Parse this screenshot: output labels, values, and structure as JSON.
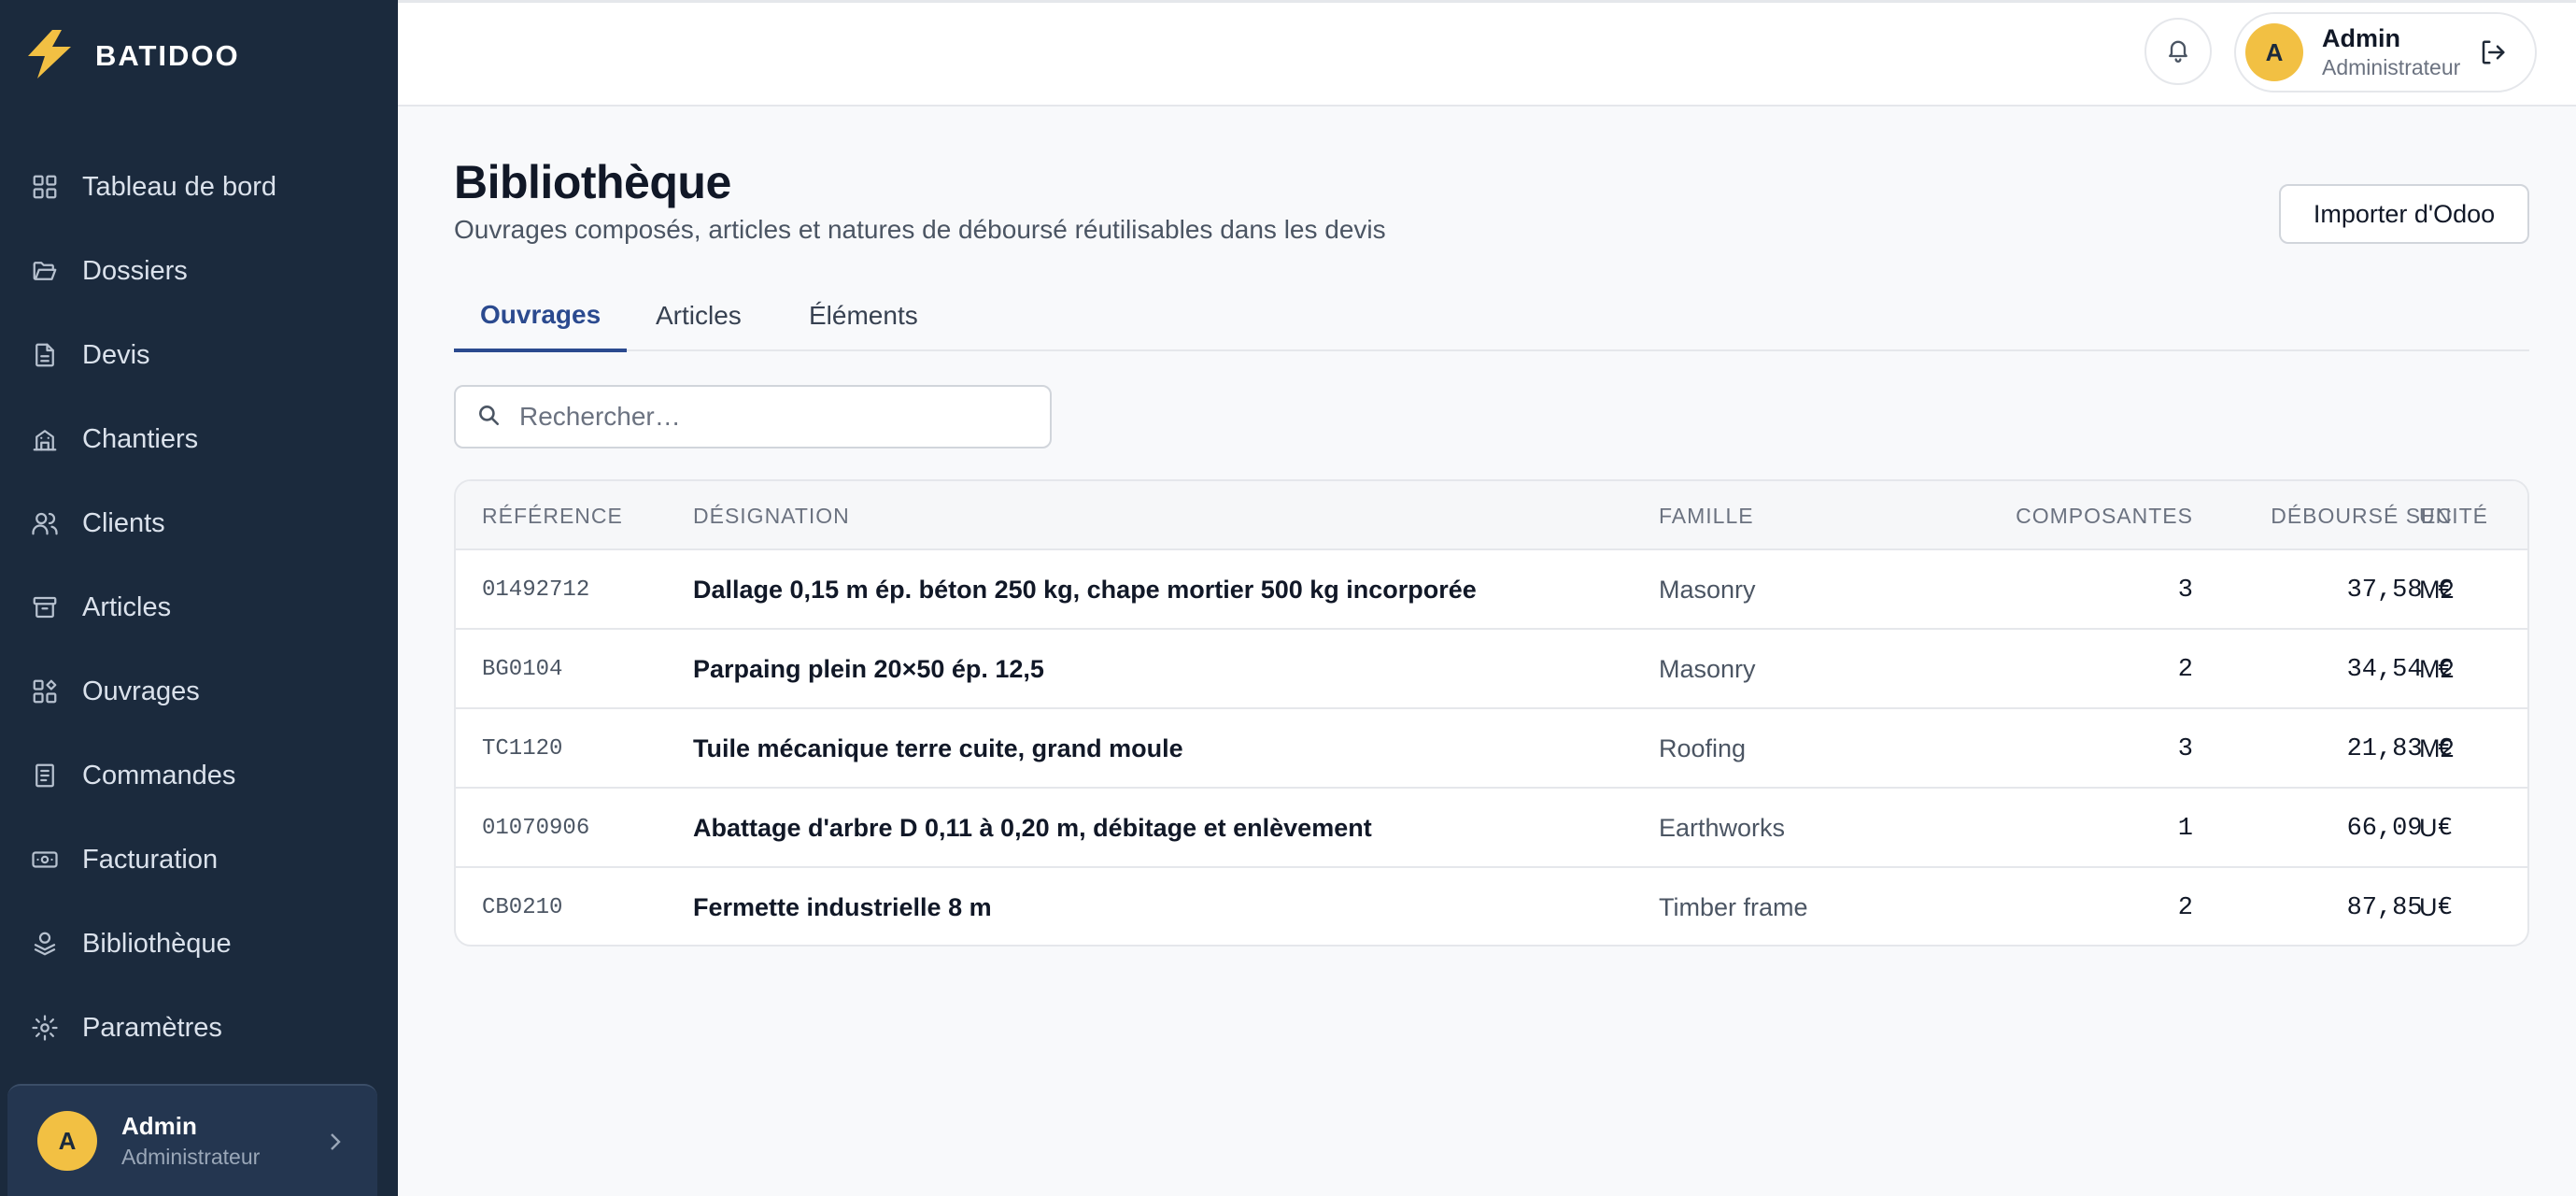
{
  "app": {
    "brand": "BATIDOO"
  },
  "sidebar": {
    "items": [
      {
        "label": "Tableau de bord",
        "icon": "dashboard-icon"
      },
      {
        "label": "Dossiers",
        "icon": "folder-open-icon"
      },
      {
        "label": "Devis",
        "icon": "file-text-icon"
      },
      {
        "label": "Chantiers",
        "icon": "building-icon"
      },
      {
        "label": "Clients",
        "icon": "users-icon"
      },
      {
        "label": "Articles",
        "icon": "archive-icon"
      },
      {
        "label": "Ouvrages",
        "icon": "blocks-icon"
      },
      {
        "label": "Commandes",
        "icon": "clipboard-list-icon"
      },
      {
        "label": "Facturation",
        "icon": "banknote-icon"
      },
      {
        "label": "Bibliothèque",
        "icon": "library-icon"
      },
      {
        "label": "Paramètres",
        "icon": "gear-icon"
      }
    ],
    "user": {
      "initial": "A",
      "name": "Admin",
      "role": "Administrateur"
    }
  },
  "topbar": {
    "user": {
      "initial": "A",
      "name": "Admin",
      "role": "Administrateur"
    }
  },
  "page": {
    "title": "Bibliothèque",
    "subtitle": "Ouvrages composés, articles et natures de déboursé réutilisables dans les devis",
    "import_label": "Importer d'Odoo"
  },
  "tabs": [
    {
      "label": "Ouvrages",
      "active": true
    },
    {
      "label": "Articles",
      "active": false
    },
    {
      "label": "Éléments",
      "active": false
    }
  ],
  "search": {
    "placeholder": "Rechercher…",
    "value": ""
  },
  "table": {
    "headers": {
      "reference": "RÉFÉRENCE",
      "designation": "DÉSIGNATION",
      "famille": "FAMILLE",
      "composantes": "COMPOSANTES",
      "debourse": "DÉBOURSÉ SEC",
      "unite": "UNITÉ"
    },
    "rows": [
      {
        "reference": "01492712",
        "designation": "Dallage 0,15 m ép. béton 250 kg, chape mortier 500 kg incorporée",
        "famille": "Masonry",
        "composantes": "3",
        "debourse": "37,58 €",
        "unite": "M2"
      },
      {
        "reference": "BG0104",
        "designation": "Parpaing plein 20×50 ép. 12,5",
        "famille": "Masonry",
        "composantes": "2",
        "debourse": "34,54 €",
        "unite": "M2"
      },
      {
        "reference": "TC1120",
        "designation": "Tuile mécanique terre cuite, grand moule",
        "famille": "Roofing",
        "composantes": "3",
        "debourse": "21,83 €",
        "unite": "M2"
      },
      {
        "reference": "01070906",
        "designation": "Abattage d'arbre D 0,11 à 0,20 m, débitage et enlèvement",
        "famille": "Earthworks",
        "composantes": "1",
        "debourse": "66,09 €",
        "unite": "U"
      },
      {
        "reference": "CB0210",
        "designation": "Fermette industrielle 8 m",
        "famille": "Timber frame",
        "composantes": "2",
        "debourse": "87,85 €",
        "unite": "U"
      }
    ]
  },
  "colors": {
    "sidebar_bg": "#1b2a3d",
    "accent": "#2b4a8f",
    "avatar": "#f2c043",
    "brand_bolt": "#f2c043"
  }
}
